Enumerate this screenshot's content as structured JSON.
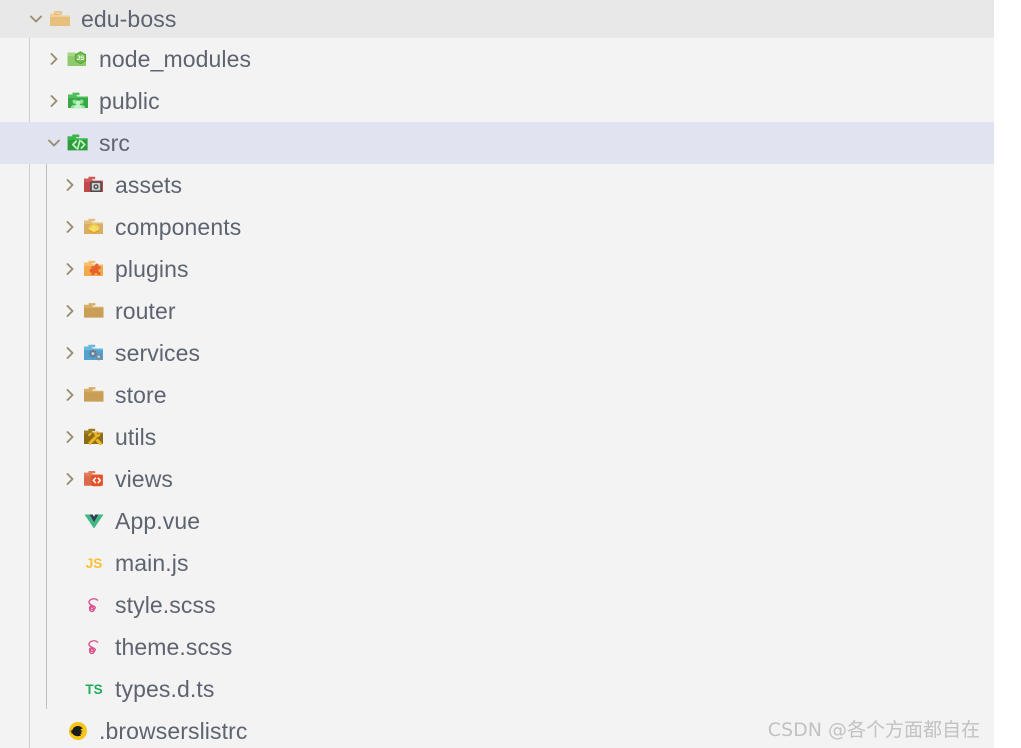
{
  "explorer": {
    "watermark": "CSDN @各个方面都自在",
    "colors": {
      "background": "#f3f3f3",
      "root_row_background": "#e8e8e8",
      "selection_background": "#e1e4f0",
      "text": "#5d6470",
      "chevron": "#9a8c6f",
      "indent_guide": "#c8c8c8"
    },
    "tree": [
      {
        "label": "edu-boss",
        "level": 0,
        "type": "folder",
        "icon": "folder-open-icon",
        "state": "expanded",
        "selected": false
      },
      {
        "label": "node_modules",
        "level": 1,
        "type": "folder",
        "icon": "folder-node-icon",
        "state": "collapsed",
        "selected": false
      },
      {
        "label": "public",
        "level": 1,
        "type": "folder",
        "icon": "folder-public-icon",
        "state": "collapsed",
        "selected": false
      },
      {
        "label": "src",
        "level": 1,
        "type": "folder",
        "icon": "folder-src-icon",
        "state": "expanded",
        "selected": true
      },
      {
        "label": "assets",
        "level": 2,
        "type": "folder",
        "icon": "folder-assets-icon",
        "state": "collapsed",
        "selected": false
      },
      {
        "label": "components",
        "level": 2,
        "type": "folder",
        "icon": "folder-components-icon",
        "state": "collapsed",
        "selected": false
      },
      {
        "label": "plugins",
        "level": 2,
        "type": "folder",
        "icon": "folder-plugins-icon",
        "state": "collapsed",
        "selected": false
      },
      {
        "label": "router",
        "level": 2,
        "type": "folder",
        "icon": "folder-plain-icon",
        "state": "collapsed",
        "selected": false
      },
      {
        "label": "services",
        "level": 2,
        "type": "folder",
        "icon": "folder-services-icon",
        "state": "collapsed",
        "selected": false
      },
      {
        "label": "store",
        "level": 2,
        "type": "folder",
        "icon": "folder-plain-icon",
        "state": "collapsed",
        "selected": false
      },
      {
        "label": "utils",
        "level": 2,
        "type": "folder",
        "icon": "folder-utils-icon",
        "state": "collapsed",
        "selected": false
      },
      {
        "label": "views",
        "level": 2,
        "type": "folder",
        "icon": "folder-views-icon",
        "state": "collapsed",
        "selected": false
      },
      {
        "label": "App.vue",
        "level": 2,
        "type": "file",
        "icon": "vue-file-icon",
        "state": "none",
        "selected": false
      },
      {
        "label": "main.js",
        "level": 2,
        "type": "file",
        "icon": "js-file-icon",
        "state": "none",
        "selected": false
      },
      {
        "label": "style.scss",
        "level": 2,
        "type": "file",
        "icon": "scss-file-icon",
        "state": "none",
        "selected": false
      },
      {
        "label": "theme.scss",
        "level": 2,
        "type": "file",
        "icon": "scss-file-icon",
        "state": "none",
        "selected": false
      },
      {
        "label": "types.d.ts",
        "level": 2,
        "type": "file",
        "icon": "typescript-def-file-icon",
        "state": "none",
        "selected": false
      },
      {
        "label": ".browserslistrc",
        "level": 1,
        "type": "file",
        "icon": "browserslist-file-icon",
        "state": "none",
        "selected": false
      }
    ]
  }
}
